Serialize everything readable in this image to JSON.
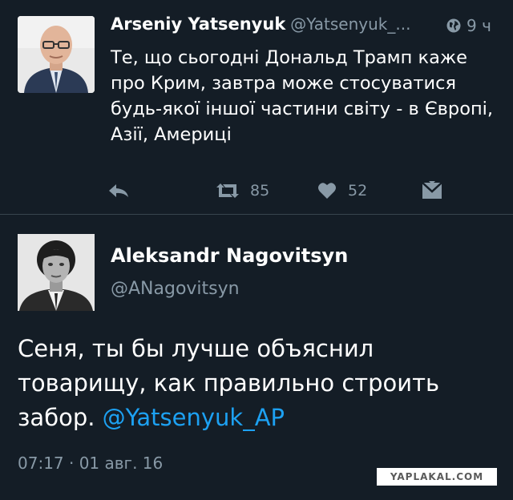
{
  "tweet1": {
    "name": "Arseniy Yatsenyuk",
    "handle": "@Yatsenyuk_...",
    "time": "9 ч",
    "text": "Те, що сьогодні Дональд Трамп каже про Крим, завтра може стосуватися будь-якої іншої частини світу - в Європі, Азії, Америці",
    "retweet_count": "85",
    "like_count": "52",
    "icons": [
      "globe-icon",
      "reply-icon",
      "retweet-icon",
      "like-icon",
      "dm-icon"
    ]
  },
  "tweet2": {
    "name": "Aleksandr Nagovitsyn",
    "handle": "@ANagovitsyn",
    "text_before": "Сеня, ты бы лучше объяснил товарищу, как правильно строить забор. ",
    "mention": "@Yatsenyuk_AP",
    "timestamp": "07:17 · 01 авг. 16"
  },
  "watermark": "YAPLAKAL.COM",
  "colors": {
    "background": "#141d26",
    "muted": "#8899a6",
    "link": "#1da1f2",
    "divider": "#38444d"
  }
}
